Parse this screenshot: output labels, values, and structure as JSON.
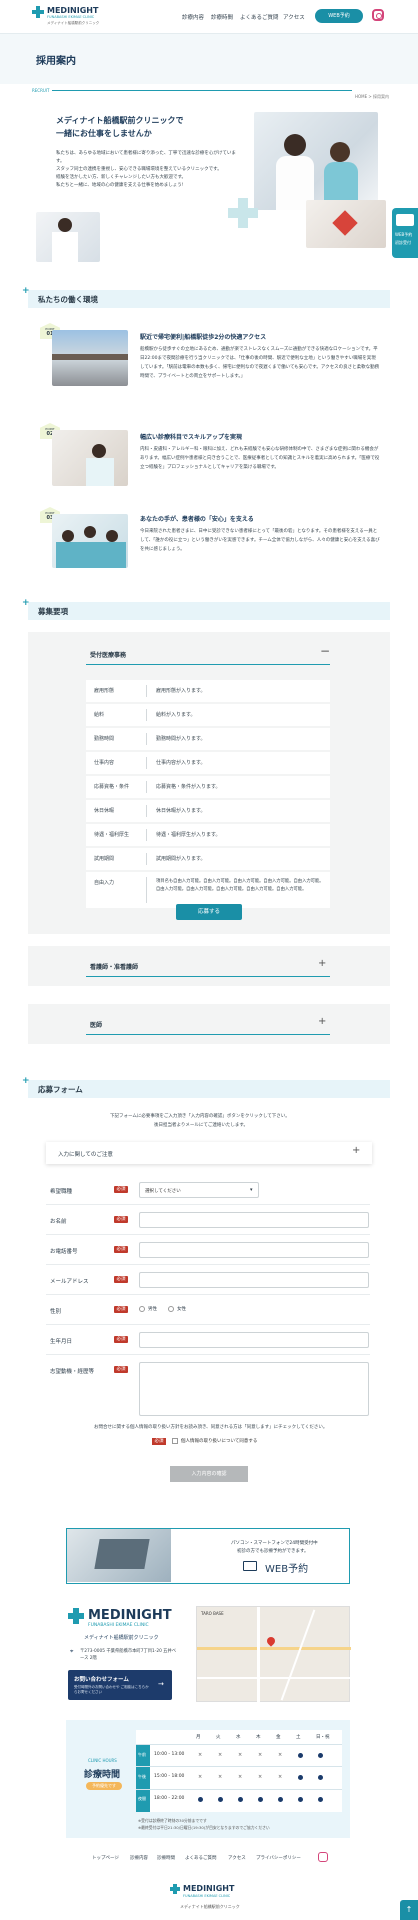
{
  "header": {
    "brand": "MEDINIGHT",
    "brand_sub": "FUNABASHI EKIMAE CLINIC",
    "brand_jp": "メディナイト船橋駅前クリニック",
    "nav": [
      "診療内容",
      "診療時間",
      "よくあるご質問",
      "アクセス"
    ],
    "web_button": "WEB予約",
    "instagram_icon": "instagram-icon"
  },
  "page_title": "採用案内",
  "breadcrumb": {
    "section": "RECRUIT",
    "path": "HOME > 採用案内"
  },
  "intro": {
    "heading": [
      "メディナイト船橋駅前クリニックで",
      "一緒にお仕事をしませんか"
    ],
    "body": [
      "私たちは、あらゆる地域において患者様に寄り添った、丁寧で迅速な診療を心がけています。",
      "スタッフ同士の連携を重視し、安心できる職場環境を整えているクリニックです。",
      "経験を活かしたい方、新しくチャレンジしたい方も大歓迎です。",
      "私たちと一緒に、地域の心の健康を支える仕事を始めましょう!"
    ]
  },
  "side_tab": {
    "line1": "WEB予約",
    "line2": "初診受付"
  },
  "environment": {
    "heading": "私たちの働く環境",
    "points": [
      {
        "label": "POINT",
        "num": "01",
        "title": "駅近で帰宅便利|船橋駅徒歩2分の快適アクセス",
        "body": "船橋駅から徒歩すぐの立地にあるため、通勤が楽でストレスなくスムーズに通勤ができる快適なロケーションです。平日22:00まで夜間診療を行う当クリニックでは、「仕事の後の時間、駅近で便利な立地」という働きやすい職場を実現しています。「駅前は電車の本数も多く、帰宅に便利なので夜遅くまで働いても安心です。アクセスの良さと柔軟な勤務時間で、プライベートとの両立をサポートします。」"
      },
      {
        "label": "POINT",
        "num": "02",
        "title": "幅広い診療科目でスキルアップを実現",
        "body": "内科・皮膚科・アレルギー科・眼科に加え、どれも未経験でも安心な研修体制の中で、さまざまな症例に関わる機会があります。幅広い症例や患者様と向き合うことで、医療従事者としての知識とスキルを着実に高められます。「医療で役立つ経験を」プロフェッショナルとしてキャリアを築ける職場です。"
      },
      {
        "label": "POINT",
        "num": "03",
        "title": "あなたの手が、患者様の「安心」を支える",
        "body": "今日来院された患者さまに、日中に受診できない患者様にとって「最後の砦」となります。その患者様を支える一員として、「誰かの役に立つ」という働きがいを実感できます。チーム全体で協力しながら、人々の健康と安心を支える喜びを共に感じましょう。"
      }
    ]
  },
  "jobs": {
    "heading": "募集要項",
    "open": {
      "title": "受付医療事務",
      "rows": [
        {
          "k": "雇用形態",
          "v": "雇用形態が入ります。"
        },
        {
          "k": "給料",
          "v": "給料が入ります。"
        },
        {
          "k": "勤務時間",
          "v": "勤務時間が入ります。"
        },
        {
          "k": "仕事内容",
          "v": "仕事内容が入ります。"
        },
        {
          "k": "応募資格・条件",
          "v": "応募資格・条件が入ります。"
        },
        {
          "k": "休日休暇",
          "v": "休日休暇が入ります。"
        },
        {
          "k": "待遇・福利厚生",
          "v": "待遇・福利厚生が入ります。"
        },
        {
          "k": "試用期間",
          "v": "試用期間が入ります。"
        },
        {
          "k": "自由入力",
          "v": "項目名も自由入力可能。自由入力可能。自由入力可能。自由入力可能。自由入力可能。自由入力可能。自由入力可能。自由入力可能。自由入力可能。自由入力可能。"
        }
      ],
      "apply": "応募する"
    },
    "closed": [
      "看護師・准看護師",
      "医師"
    ]
  },
  "form": {
    "heading": "応募フォーム",
    "intro": [
      "下記フォームに必要事項をご入力頂き「入力内容の確認」ボタンをクリックして下さい。",
      "後日担当者よりメールにてご連絡いたします。"
    ],
    "notice": "入力に関してのご注意",
    "required": "必須",
    "fields": [
      {
        "label": "希望職種",
        "placeholder": "選択してください"
      },
      {
        "label": "お名前"
      },
      {
        "label": "お電話番号"
      },
      {
        "label": "メールアドレス"
      },
      {
        "label": "性別",
        "options": [
          "男性",
          "女性"
        ]
      },
      {
        "label": "生年月日"
      },
      {
        "label": "志望動機・経歴等"
      }
    ],
    "agree_text": "お問合せに関する個人情報の取り扱い方針をお読み頂き、同意される方は「同意します」にチェックしてください。",
    "agree_label": "個人情報の取り扱いについて同意する",
    "confirm": "入力内容の確認"
  },
  "banner": {
    "line1": "パソコン・スマートフォンで24時間受付中",
    "line2": "初診の方でも診療予約ができます。",
    "cta": "WEB予約"
  },
  "footer_info": {
    "brand": "MEDINIGHT",
    "brand_sub": "FUNABASHI EKIMAE CLINIC",
    "brand_jp": "メディナイト船橋駅前クリニック",
    "address": "〒273-0005 千葉県船橋市本町7丁目1-20 五井ベース 2階",
    "contact_title": "お問い合わせフォーム",
    "contact_body": "受付時間外のお問い合わせや ご相談はこちらからお寄せください"
  },
  "hours": {
    "en": "CLINIC HOURS",
    "title": "診療時間",
    "pill": "予約優先です",
    "days": [
      "月",
      "火",
      "水",
      "木",
      "金",
      "土",
      "日・祝"
    ],
    "groups": [
      "午前",
      "午後",
      "夜間"
    ],
    "slots": [
      "10:00 - 13:00",
      "15:00 - 18:00",
      "18:00 - 22:00"
    ],
    "grid": [
      [
        "×",
        "×",
        "×",
        "×",
        "×",
        "●",
        "●"
      ],
      [
        "×",
        "×",
        "×",
        "×",
        "×",
        "●",
        "●"
      ],
      [
        "●",
        "●",
        "●",
        "●",
        "●",
        "●",
        "●"
      ]
    ],
    "notes": [
      "※受付は診療終了時刻の30分前までです",
      "※最終受付は平日21:30/日曜日(19:30)が目安となりますのでご協力ください"
    ]
  },
  "footer_nav": [
    "トップページ",
    "診療内容",
    "診療時間",
    "よくあるご質問",
    "アクセス",
    "プライバシーポリシー"
  ],
  "footer_brand": {
    "name": "MEDINIGHT",
    "sub": "FUNABASHI EKIMAE CLINIC",
    "jp": "メディナイト船橋駅前クリニック"
  },
  "map_label": "TARO BASE"
}
